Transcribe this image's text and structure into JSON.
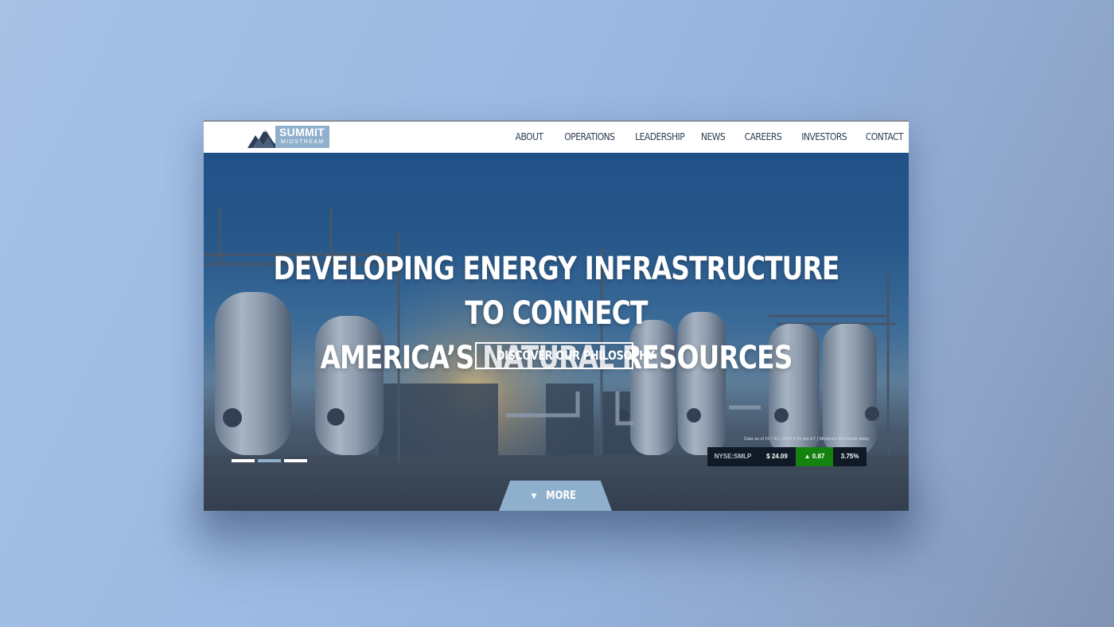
{
  "brand": {
    "name_line1": "SUMMIT",
    "name_line2": "MIDSTREAM",
    "accent_color": "#8fb0cc",
    "nav_text_color": "#2f3e55"
  },
  "nav": {
    "items": [
      "ABOUT",
      "OPERATIONS",
      "LEADERSHIP",
      "NEWS",
      "CAREERS",
      "INVESTORS",
      "CONTACT"
    ]
  },
  "hero": {
    "headline_line1": "DEVELOPING ENERGY INFRASTRUCTURE TO CONNECT",
    "headline_line2": "AMERICA’S NATURAL RESOURCES",
    "cta_label": "DISCOVER OUR PHILOSOPHY",
    "slides_count": 3,
    "active_slide": 2
  },
  "stock": {
    "note": "Data as of 01 / 31 / 2022 4:10 pm ET | Minimum 20 minute delay",
    "symbol": "NYSE:SMLP",
    "price": "$ 24.09",
    "change": "0.87",
    "change_direction_icon": "up-triangle-icon",
    "percent": "3.75%",
    "up_color": "#14820f"
  },
  "more": {
    "label": "MORE",
    "icon": "caret-down-icon"
  }
}
